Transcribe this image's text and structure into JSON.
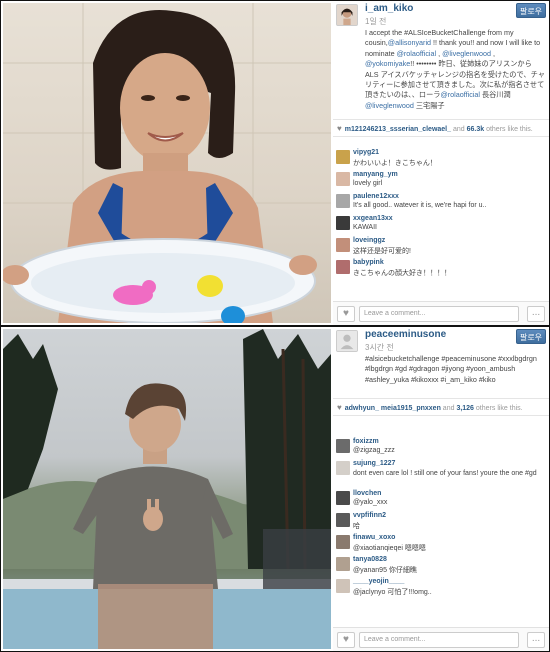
{
  "post1": {
    "username": "i_am_kiko",
    "time": "1일 전",
    "follow_label": "팔로우",
    "caption": {
      "part1": "I accept the #ALSIceBucketChallenge from my cousin,",
      "mention1": "@allisonyarid",
      "part2": " !! thank you!! and now I will like to nominate ",
      "mention2": "@rolaofficial",
      "part3": " , ",
      "mention3": "@liveglenwood",
      "part4": " , ",
      "mention4": "@yokomiyake",
      "part5": "!! •••••••• 昨日、従姉妹のアリスンからALS アイスバケッチャレンジの指名を受けたので、チャリティーに参加させて頂きました。次に私が指名させて頂きたいのは、、ローラ",
      "mention5": "@rolaofficial",
      "part6": " 長谷川潤",
      "mention6": "@liveglenwood",
      "part7": " 三宅陽子"
    },
    "likes": {
      "users": "m121246213_ssserian_clewael_",
      "rest": " and ",
      "count": "66.3k",
      "suffix": " others like this."
    },
    "comments": [
      {
        "user": "vipyg21",
        "text": "かわいいよ！きこちゃん！",
        "avatar_color": "#c9a24b"
      },
      {
        "user": "manyang_ym",
        "text": "lovely girl",
        "avatar_color": "#d9b8a4"
      },
      {
        "user": "paulene12xxx",
        "text": "It's all good.. watever it is, we're hapi for u..",
        "avatar_color": "#a7a7a7"
      },
      {
        "user": "xxgean13xx",
        "text": "KAWAII",
        "avatar_color": "#3a3a3a"
      },
      {
        "user": "loveinggz",
        "text": "这样还是好可爱的!",
        "avatar_color": "#c28f7a"
      },
      {
        "user": "babypink",
        "text": "きこちゃんの顔大好き！！！！",
        "avatar_color": "#b06d6d"
      }
    ],
    "comment_placeholder": "Leave a comment...",
    "more_label": "..."
  },
  "post2": {
    "username": "peaceeminusone",
    "time": "3시간 전",
    "follow_label": "팔로우",
    "caption": "#alsicebucketchallenge #peaceminusone #xxxlbgdrgn #lbgdrgn #gd #gdragon #jiyong #yoon_ambush #ashley_yuka #kikoxxx #i_am_kiko #kiko",
    "likes": {
      "users": "adwhyun_ meia1915_pnxxen",
      "rest": " and ",
      "count": "3,126",
      "suffix": " others like this."
    },
    "comments": [
      {
        "user": "foxizzm",
        "text": "@zigzag_zzz",
        "avatar_color": "#6b6b6b"
      },
      {
        "user": "sujung_1227",
        "text": "dont even care lol ! still one of your fans! youre the one #gd",
        "avatar_color": "#d4cfc9"
      },
      {
        "user": "llovchen",
        "text": "@yalo_xxx",
        "avatar_color": "#4a4a4a"
      },
      {
        "user": "vvpfifinn2",
        "text": "哈",
        "avatar_color": "#5a5a5a"
      },
      {
        "user": "finawu_xoxo",
        "text": "@xiaotianqieqei 嗯嗯嗯",
        "avatar_color": "#8a7a6e"
      },
      {
        "user": "tanya0828",
        "text": "@yanan95 你仔細瞧",
        "avatar_color": "#b0a090"
      },
      {
        "user": "____yeojin____",
        "text": "@jaclynyo 可怕了!!!omg..",
        "avatar_color": "#cfc3b8"
      }
    ],
    "comment_placeholder": "Leave a comment...",
    "more_label": "..."
  }
}
